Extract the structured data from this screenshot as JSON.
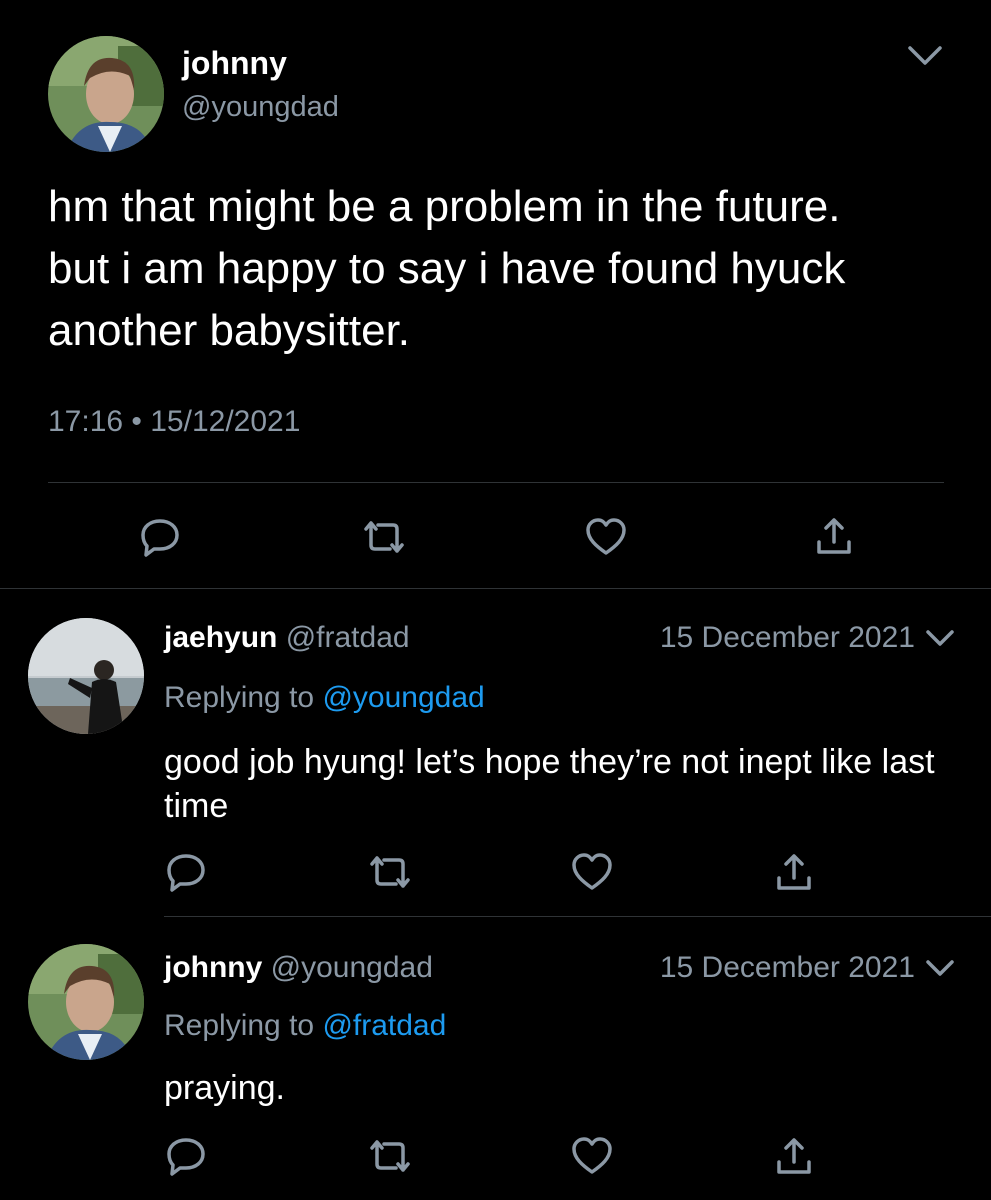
{
  "main_tweet": {
    "display_name": "johnny",
    "handle": "@youngdad",
    "text": "hm that might be a problem in the future. but i am happy to say i have found hyuck another babysitter.",
    "timestamp": "17:16 • 15/12/2021"
  },
  "replies": [
    {
      "display_name": "jaehyun",
      "handle": "@fratdad",
      "date": "15 December 2021",
      "replying_prefix": "Replying to ",
      "replying_handle": "@youngdad",
      "text": "good job hyung! let’s hope they’re not inept like last time"
    },
    {
      "display_name": "johnny",
      "handle": "@youngdad",
      "date": "15 December 2021",
      "replying_prefix": "Replying to ",
      "replying_handle": "@fratdad",
      "text": "praying."
    }
  ],
  "colors": {
    "background": "#000000",
    "muted": "#8b98a5",
    "link": "#1d9bf0",
    "divider": "#2f3336"
  },
  "icons": [
    "chevron-down-icon",
    "reply-icon",
    "retweet-icon",
    "like-icon",
    "share-icon"
  ]
}
